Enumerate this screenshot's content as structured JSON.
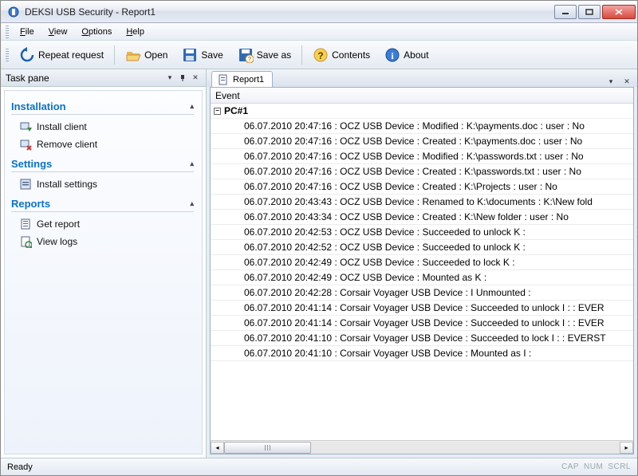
{
  "window": {
    "title": "DEKSI USB Security - Report1"
  },
  "menu": {
    "file": "File",
    "view": "View",
    "options": "Options",
    "help": "Help"
  },
  "toolbar": {
    "repeat_request": "Repeat request",
    "open": "Open",
    "save": "Save",
    "save_as": "Save as",
    "contents": "Contents",
    "about": "About"
  },
  "taskpane": {
    "title": "Task pane",
    "sections": {
      "installation": {
        "title": "Installation",
        "items": [
          "Install client",
          "Remove client"
        ]
      },
      "settings": {
        "title": "Settings",
        "items": [
          "Install settings"
        ]
      },
      "reports": {
        "title": "Reports",
        "items": [
          "Get report",
          "View logs"
        ]
      }
    }
  },
  "report": {
    "tab_label": "Report1",
    "column_header": "Event",
    "group_label": "PC#1",
    "events": [
      "06.07.2010 20:47:16 : OCZ USB Device : Modified : K:\\payments.doc : user : No",
      "06.07.2010 20:47:16 : OCZ USB Device : Created : K:\\payments.doc : user : No",
      "06.07.2010 20:47:16 : OCZ USB Device : Modified : K:\\passwords.txt : user : No",
      "06.07.2010 20:47:16 : OCZ USB Device : Created : K:\\passwords.txt : user : No",
      "06.07.2010 20:47:16 : OCZ USB Device : Created : K:\\Projects : user : No",
      "06.07.2010 20:43:43 : OCZ USB Device : Renamed to K:\\documents : K:\\New fold",
      "06.07.2010 20:43:34 : OCZ USB Device : Created : K:\\New folder : user : No",
      "06.07.2010 20:42:53 : OCZ USB Device : Succeeded to unlock K :",
      "06.07.2010 20:42:52 : OCZ USB Device : Succeeded to unlock K :",
      "06.07.2010 20:42:49 : OCZ USB Device : Succeeded to lock K :",
      "06.07.2010 20:42:49 : OCZ USB Device : Mounted as K :",
      "06.07.2010 20:42:28 : Corsair Voyager USB Device : I Unmounted :",
      "06.07.2010 20:41:14 : Corsair Voyager USB Device : Succeeded to unlock I :  : EVER",
      "06.07.2010 20:41:14 : Corsair Voyager USB Device : Succeeded to unlock I :  : EVER",
      "06.07.2010 20:41:10 : Corsair Voyager USB Device : Succeeded to lock I :  : EVERST",
      "06.07.2010 20:41:10 : Corsair Voyager USB Device : Mounted as I :"
    ]
  },
  "statusbar": {
    "text": "Ready",
    "cap": "CAP",
    "num": "NUM",
    "scrl": "SCRL"
  }
}
